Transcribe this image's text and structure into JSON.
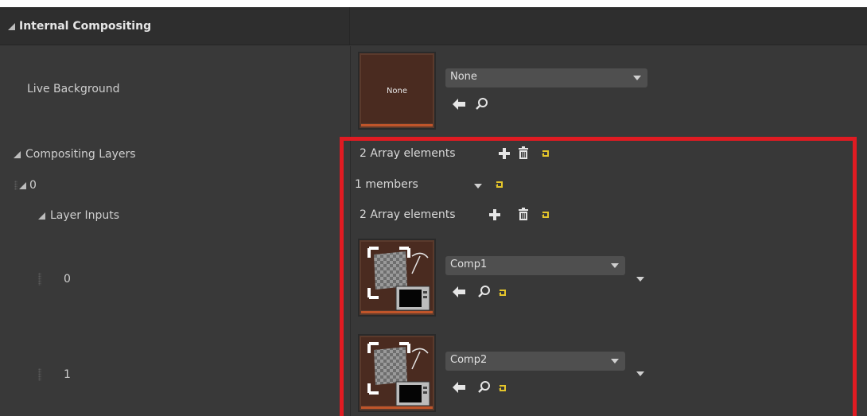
{
  "section": {
    "title": "Internal Compositing"
  },
  "live_background": {
    "label": "Live Background",
    "thumbnail_text": "None",
    "combo_value": "None"
  },
  "compositing_layers": {
    "label": "Compositing Layers",
    "array_text": "2 Array elements"
  },
  "element0": {
    "index_label": "0",
    "members_text": "1 members"
  },
  "layer_inputs": {
    "label": "Layer Inputs",
    "array_text": "2 Array elements",
    "items": [
      {
        "index": "0",
        "combo_value": "Comp1"
      },
      {
        "index": "1",
        "combo_value": "Comp2"
      }
    ]
  },
  "colors": {
    "highlight_box": "#e01b22",
    "reset_arrow": "#e5c62b",
    "panel_bg": "#393939"
  },
  "icons": [
    "add-icon",
    "trash-icon",
    "reset-icon",
    "browse-back-icon",
    "search-icon",
    "chevron-down-icon"
  ]
}
